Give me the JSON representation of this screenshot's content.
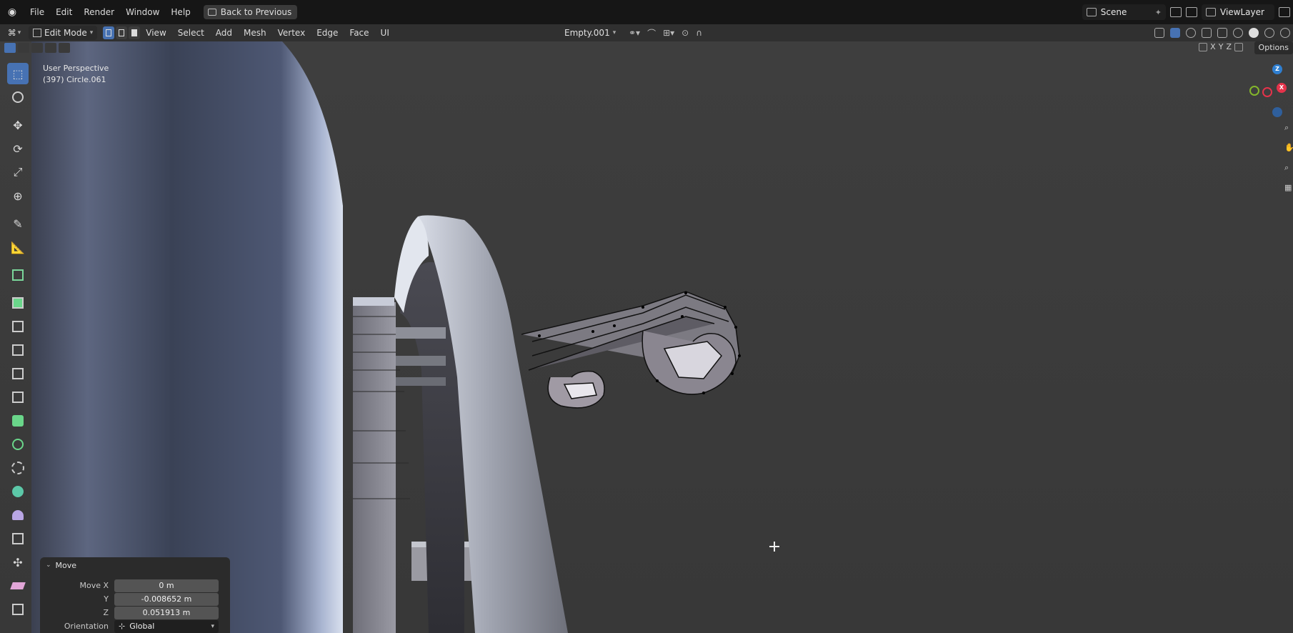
{
  "topbar": {
    "menus": [
      "File",
      "Edit",
      "Render",
      "Window",
      "Help"
    ],
    "back_label": "Back to Previous",
    "scene": "Scene",
    "view_layer": "ViewLayer"
  },
  "header": {
    "mode": "Edit Mode",
    "menus": [
      "View",
      "Select",
      "Add",
      "Mesh",
      "Vertex",
      "Edge",
      "Face",
      "UI"
    ],
    "pivot_object": "Empty.001"
  },
  "row2": {
    "axes": [
      "X",
      "Y",
      "Z"
    ],
    "options_label": "Options"
  },
  "viewport": {
    "perspective_label": "User Perspective",
    "object_label": "(397) Circle.061",
    "gizmo": {
      "z": "Z",
      "x": "X",
      "y": "Y"
    }
  },
  "operator_panel": {
    "title": "Move",
    "move_x_label": "Move X",
    "move_x": "0 m",
    "y_label": "Y",
    "y": "-0.008652 m",
    "z_label": "Z",
    "z": "0.051913 m",
    "orientation_label": "Orientation",
    "orientation": "Global"
  },
  "colors": {
    "accent": "#4772b3",
    "topbar_bg": "#161616",
    "header_bg": "#303030",
    "viewport_bg": "#3d3d3d",
    "axis_x": "#e5334b",
    "axis_y": "#84b62b",
    "axis_z": "#2f7fd1"
  },
  "icons": {
    "tools": [
      "select-box-icon",
      "cursor-icon",
      "move-icon",
      "rotate-icon",
      "scale-icon",
      "transform-icon",
      "annotate-icon",
      "measure-icon",
      "add-cube-icon",
      "extrude-icon",
      "inset-icon",
      "bevel-icon",
      "loop-cut-icon",
      "knife-icon",
      "poly-build-icon",
      "spin-icon",
      "smooth-icon",
      "edge-slide-icon",
      "shrink-fatten-icon",
      "shear-icon",
      "to-sphere-icon",
      "rip-icon"
    ]
  }
}
